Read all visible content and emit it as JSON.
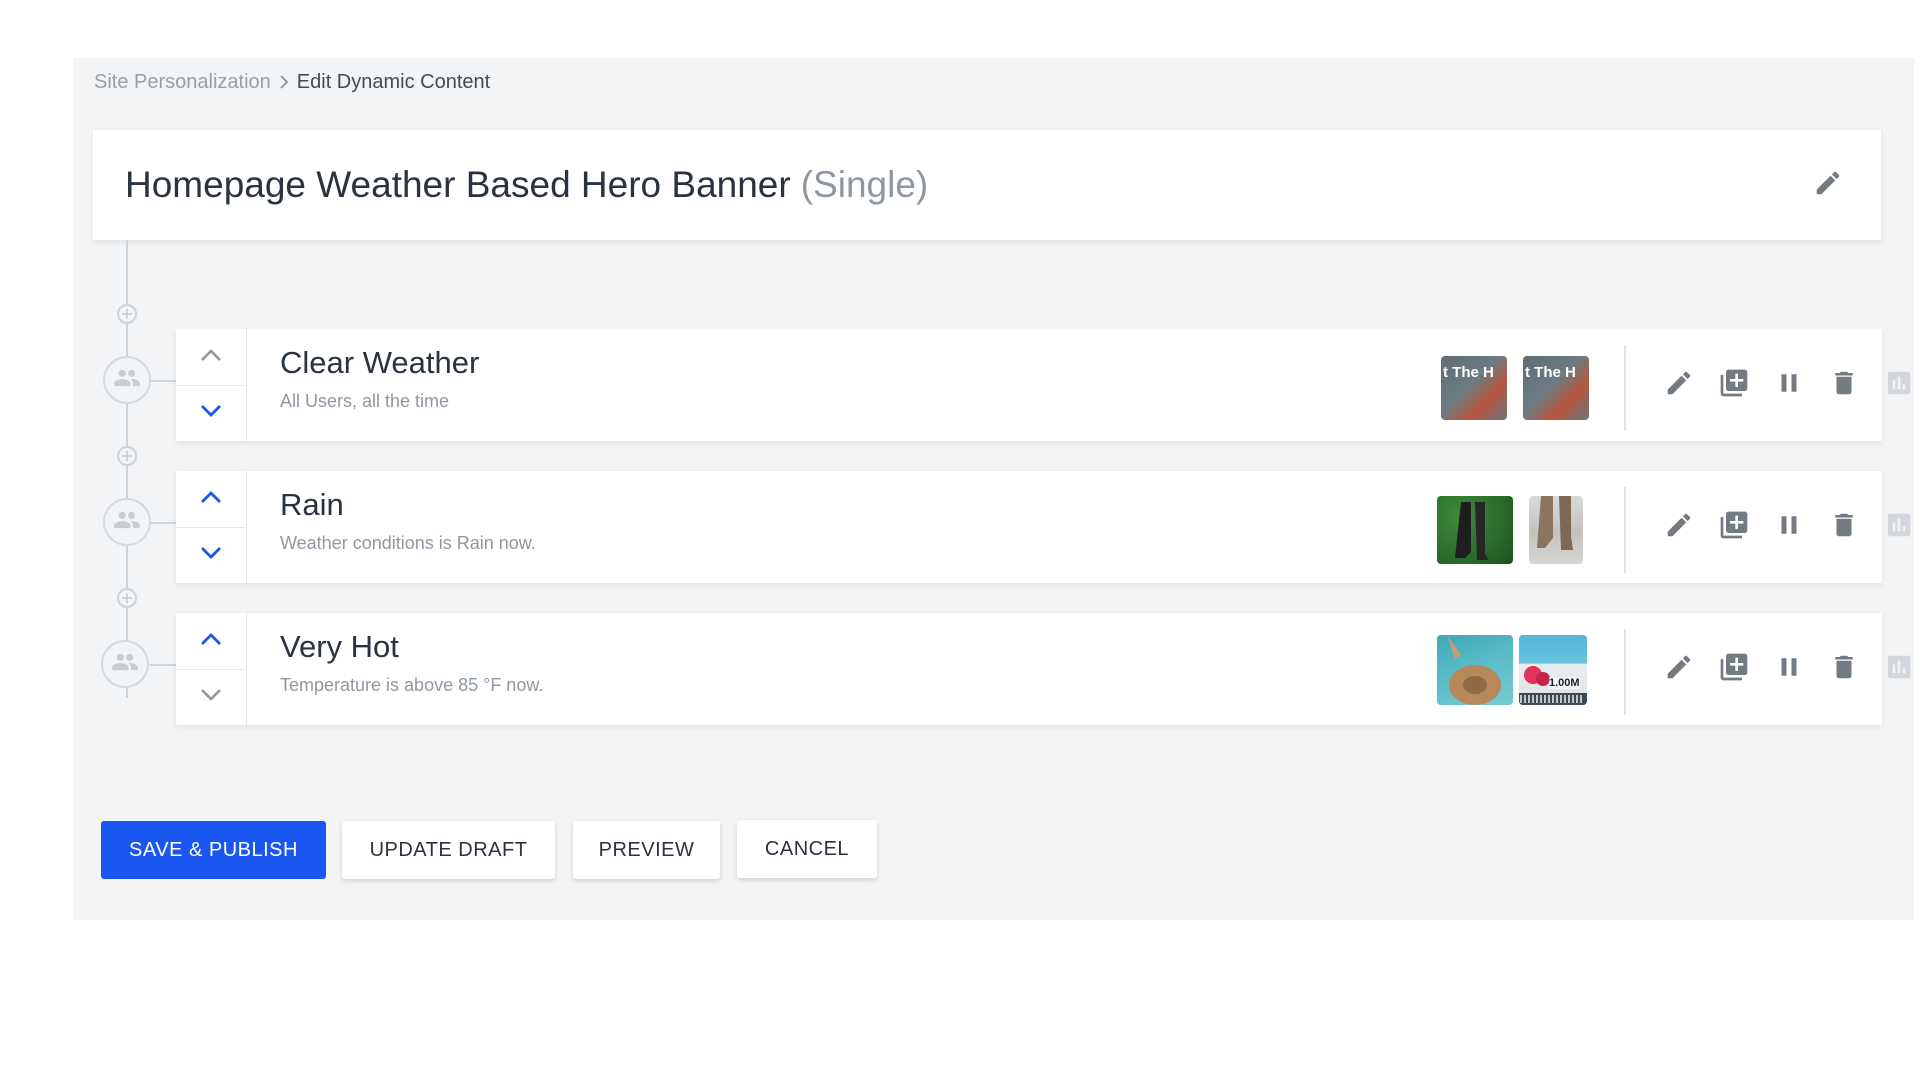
{
  "breadcrumb": {
    "parent": "Site Personalization",
    "current": "Edit Dynamic Content"
  },
  "header": {
    "title": "Homepage Weather Based Hero Banner",
    "suffix": "(Single)"
  },
  "rules": [
    {
      "name": "Clear Weather",
      "description": "All Users, all the time",
      "thumbnails": [
        {
          "overlay": "t The H",
          "subtitle": ""
        },
        {
          "overlay": "t The H",
          "subtitle": ""
        }
      ],
      "up_enabled": false,
      "down_enabled": true
    },
    {
      "name": "Rain",
      "description": "Weather conditions is Rain now.",
      "thumbnails": [
        {
          "overlay": "",
          "subtitle": ""
        },
        {
          "overlay": "",
          "subtitle": ""
        }
      ],
      "up_enabled": true,
      "down_enabled": true
    },
    {
      "name": "Very Hot",
      "description": "Temperature is above 85 °F now.",
      "thumbnails": [
        {
          "overlay": "",
          "subtitle": ""
        },
        {
          "overlay": "",
          "subtitle": "1.00M"
        }
      ],
      "up_enabled": true,
      "down_enabled": false
    }
  ],
  "buttons": {
    "save_publish": "SAVE & PUBLISH",
    "update_draft": "UPDATE DRAFT",
    "preview": "PREVIEW",
    "cancel": "CANCEL"
  },
  "icons": {
    "edit": "pencil-icon",
    "add_variation": "add-copy-icon",
    "pause": "pause-icon",
    "delete": "trash-icon",
    "report": "bar-chart-icon",
    "audience": "people-icon",
    "add_rule": "plus-circle-icon"
  },
  "colors": {
    "accent": "#1a56f0",
    "background": "#f2f4f6",
    "icon": "#737a82",
    "icon_disabled": "#d3d7db"
  }
}
